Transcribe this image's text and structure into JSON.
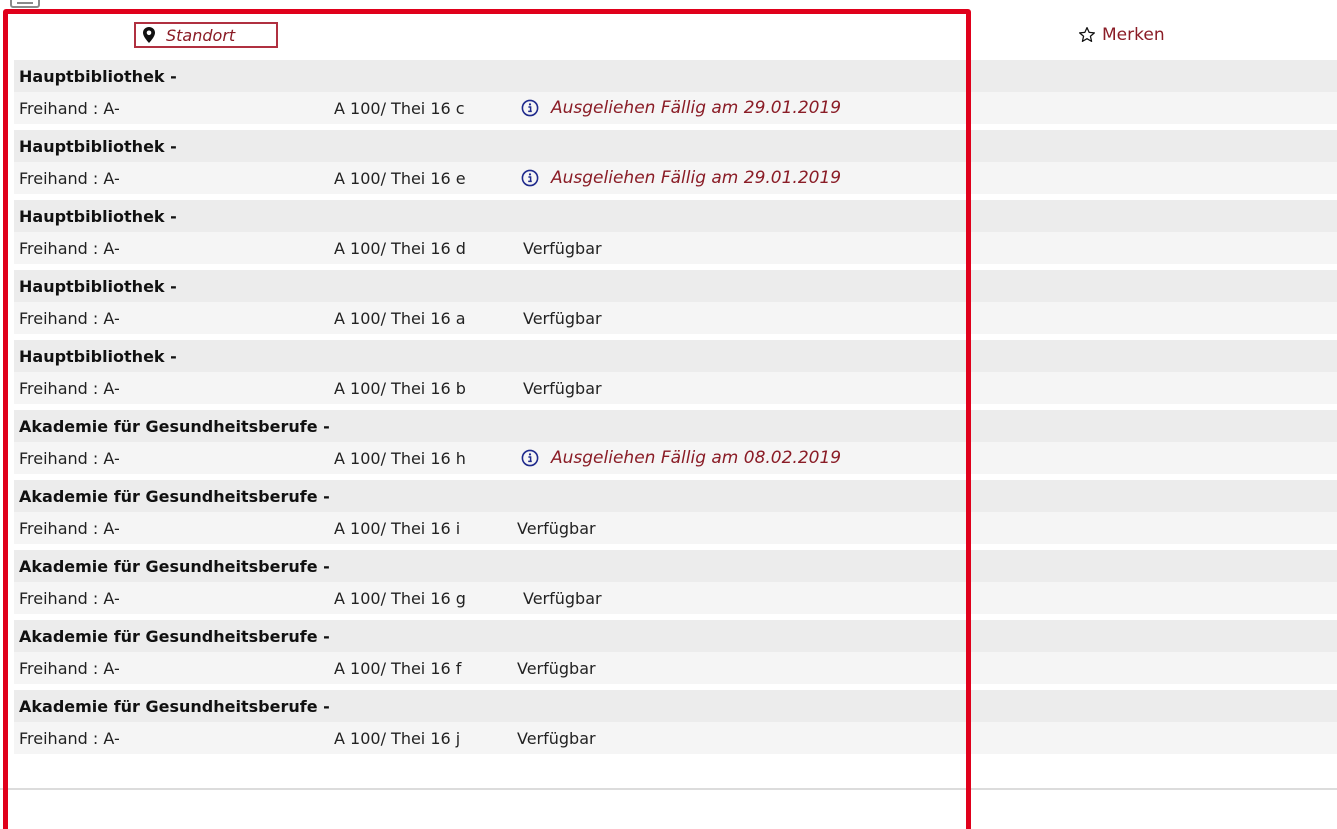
{
  "header": {
    "location_label": "Standort",
    "bookmark_label": "Merken"
  },
  "holdings": [
    {
      "library": "Hauptbibliothek -",
      "shelf": "Freihand : A-",
      "signature": "A 100/ Thei 16 c",
      "status": "Ausgeliehen Fällig am 29.01.2019",
      "loaned": true
    },
    {
      "library": "Hauptbibliothek -",
      "shelf": "Freihand : A-",
      "signature": "A 100/ Thei 16 e",
      "status": "Ausgeliehen Fällig am 29.01.2019",
      "loaned": true
    },
    {
      "library": "Hauptbibliothek -",
      "shelf": "Freihand : A-",
      "signature": "A 100/ Thei 16 d",
      "status": "Verfügbar",
      "loaned": false
    },
    {
      "library": "Hauptbibliothek -",
      "shelf": "Freihand : A-",
      "signature": "A 100/ Thei 16 a",
      "status": "Verfügbar",
      "loaned": false
    },
    {
      "library": "Hauptbibliothek -",
      "shelf": "Freihand : A-",
      "signature": "A 100/ Thei 16 b",
      "status": "Verfügbar",
      "loaned": false
    },
    {
      "library": "Akademie für Gesundheitsberufe -",
      "shelf": "Freihand : A-",
      "signature": "A 100/ Thei 16 h",
      "status": "Ausgeliehen Fällig am 08.02.2019",
      "loaned": true
    },
    {
      "library": "Akademie für Gesundheitsberufe -",
      "shelf": "Freihand : A-",
      "signature": "A 100/ Thei 16 i",
      "status": "Verfügbar",
      "loaned": false
    },
    {
      "library": "Akademie für Gesundheitsberufe -",
      "shelf": "Freihand : A-",
      "signature": "A 100/ Thei 16 g",
      "status": "Verfügbar",
      "loaned": false
    },
    {
      "library": "Akademie für Gesundheitsberufe -",
      "shelf": "Freihand : A-",
      "signature": "A 100/ Thei 16 f",
      "status": "Verfügbar",
      "loaned": false
    },
    {
      "library": "Akademie für Gesundheitsberufe -",
      "shelf": "Freihand : A-",
      "signature": "A 100/ Thei 16 j",
      "status": "Verfügbar",
      "loaned": false
    }
  ],
  "icons": {
    "location": "map-pin-icon",
    "bookmark": "star-outline-icon",
    "info": "info-circle-icon"
  },
  "colors": {
    "accent": "#8a1c26",
    "highlight_frame": "#e0001b",
    "info_icon": "#1f2a8c",
    "row_head_bg": "#ececec",
    "row_body_bg": "#f5f5f5"
  }
}
